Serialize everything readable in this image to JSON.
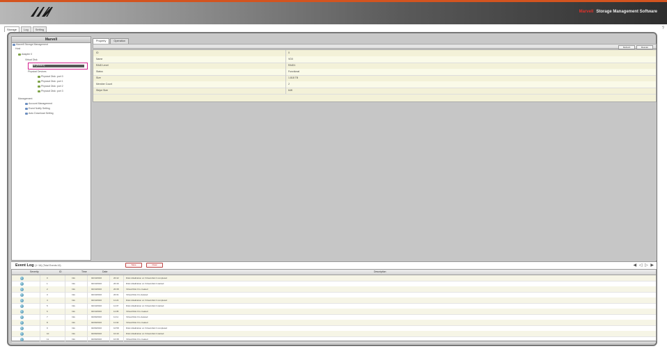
{
  "header": {
    "brand_red": "Marvell",
    "brand_text": "Storage Management Software"
  },
  "top_tabs": [
    "Storage",
    "Log",
    "Setting"
  ],
  "left_panel": {
    "title": "Marvell",
    "tree": [
      "Marvell Storage Management",
      "Host",
      "Adapter 0",
      "Virtual Disk",
      "VD0 (RAID1)",
      "Physical Devices",
      "Physical Disk: port 0",
      "Physical Disk: port 1",
      "Physical Disk: port 2",
      "Physical Disk: port 3",
      "Management",
      "Account Management",
      "Event Notify Setting",
      "Auto Download Setting"
    ]
  },
  "right_panel": {
    "tabs": [
      "Property",
      "Operation"
    ],
    "buttons": [
      "Refresh",
      "Rescan"
    ],
    "properties": [
      {
        "key": "ID",
        "value": "0"
      },
      {
        "key": "Name",
        "value": "VD0"
      },
      {
        "key": "RAID Level",
        "value": "RAID1"
      },
      {
        "key": "Status",
        "value": "Functional"
      },
      {
        "key": "Size",
        "value": "1.818 TB"
      },
      {
        "key": "Member Count",
        "value": "2"
      },
      {
        "key": "Stripe Size",
        "value": "64K"
      }
    ]
  },
  "event_log": {
    "title": "Event Log",
    "subtitle": "(1~16) (Total Events:16)",
    "buttons": [
      "Save",
      "Clear"
    ],
    "nav_icons": "◀ ◁ ▷ ▶",
    "columns": [
      "Severity",
      "ID",
      "Time",
      "Date",
      "Description"
    ],
    "rows": [
      {
        "id": "0",
        "time": "20:42",
        "date": "02/10/2016",
        "desc": "Disk initialization on Virtual disk 0 completed"
      },
      {
        "id": "1",
        "time": "20:40",
        "date": "02/10/2016",
        "desc": "Disk initialization on Virtual disk 0 started"
      },
      {
        "id": "2",
        "time": "20:38",
        "date": "02/10/2016",
        "desc": "Virtual Disk 0 is created"
      },
      {
        "id": "3",
        "time": "20:31",
        "date": "02/10/2016",
        "desc": "Virtual Disk 0 is deleted"
      },
      {
        "id": "4",
        "time": "11:22",
        "date": "02/10/2016",
        "desc": "Disk initialization on Virtual disk 0 completed"
      },
      {
        "id": "5",
        "time": "11:07",
        "date": "02/10/2016",
        "desc": "Disk initialization on Virtual disk 0 started"
      },
      {
        "id": "6",
        "time": "11:05",
        "date": "02/10/2016",
        "desc": "Virtual Disk 0 is created"
      },
      {
        "id": "7",
        "time": "11:11",
        "date": "02/09/2016",
        "desc": "Virtual Disk 0 is deleted"
      },
      {
        "id": "8",
        "time": "11:02",
        "date": "02/09/2016",
        "desc": "Virtual Disk 0 is created"
      },
      {
        "id": "9",
        "time": "10:58",
        "date": "02/09/2016",
        "desc": "Disk initialization on Virtual disk 0 completed"
      },
      {
        "id": "10",
        "time": "10:40",
        "date": "02/09/2016",
        "desc": "Disk initialization on Virtual disk 0 started"
      },
      {
        "id": "11",
        "time": "10:38",
        "date": "02/09/2016",
        "desc": "Virtual Disk 0 is created"
      }
    ],
    "severity_label": "Info"
  }
}
